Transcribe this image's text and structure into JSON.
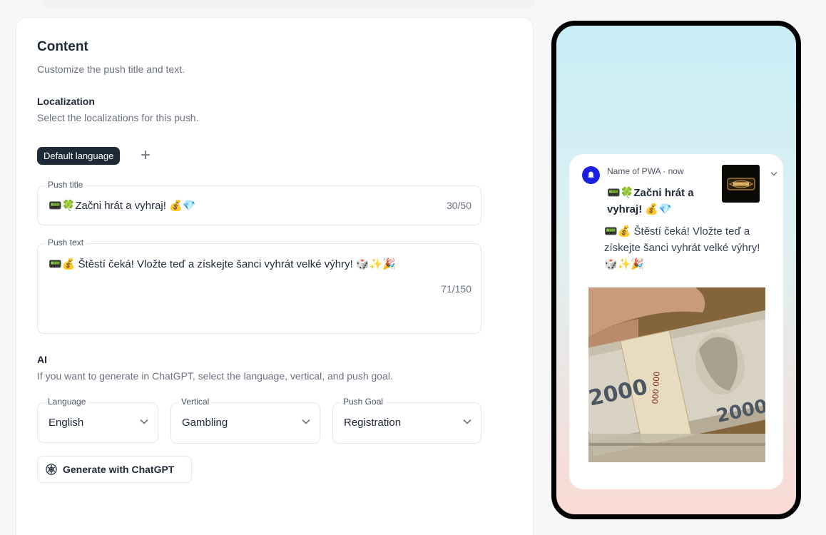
{
  "content": {
    "title": "Content",
    "subtitle": "Customize the push title and text."
  },
  "localization": {
    "title": "Localization",
    "subtitle": "Select the localizations for this push.",
    "chip": "Default language",
    "add_icon": "plus-icon"
  },
  "push_title": {
    "label": "Push title",
    "value": "📟🍀Začni hrát a vyhraj! 💰💎",
    "counter": "30/50"
  },
  "push_text": {
    "label": "Push text",
    "value": "📟💰 Štěstí čeká! Vložte teď a získejte šanci vyhrát velké výhry! 🎲✨🎉",
    "counter": "71/150"
  },
  "ai": {
    "title": "AI",
    "subtitle": "If you want to generate in ChatGPT, select the language, vertical, and push goal.",
    "language": {
      "label": "Language",
      "value": "English"
    },
    "vertical": {
      "label": "Vertical",
      "value": "Gambling"
    },
    "goal": {
      "label": "Push Goal",
      "value": "Registration"
    },
    "button": "Generate with ChatGPT",
    "button_icon": "chatgpt-icon"
  },
  "preview": {
    "app_meta": "Name of PWA · now",
    "title": "📟🍀Začni hrát a vyhraj! 💰💎",
    "body": "📟💰 Štěstí čeká! Vložte teď a získejte šanci vyhrát velké výhry! 🎲✨🎉",
    "image": "czech-banknotes-photo",
    "logo": "casino-logo"
  },
  "colors": {
    "accent_dark": "#1f2a37",
    "notif_bell": "#1a1fe0"
  }
}
